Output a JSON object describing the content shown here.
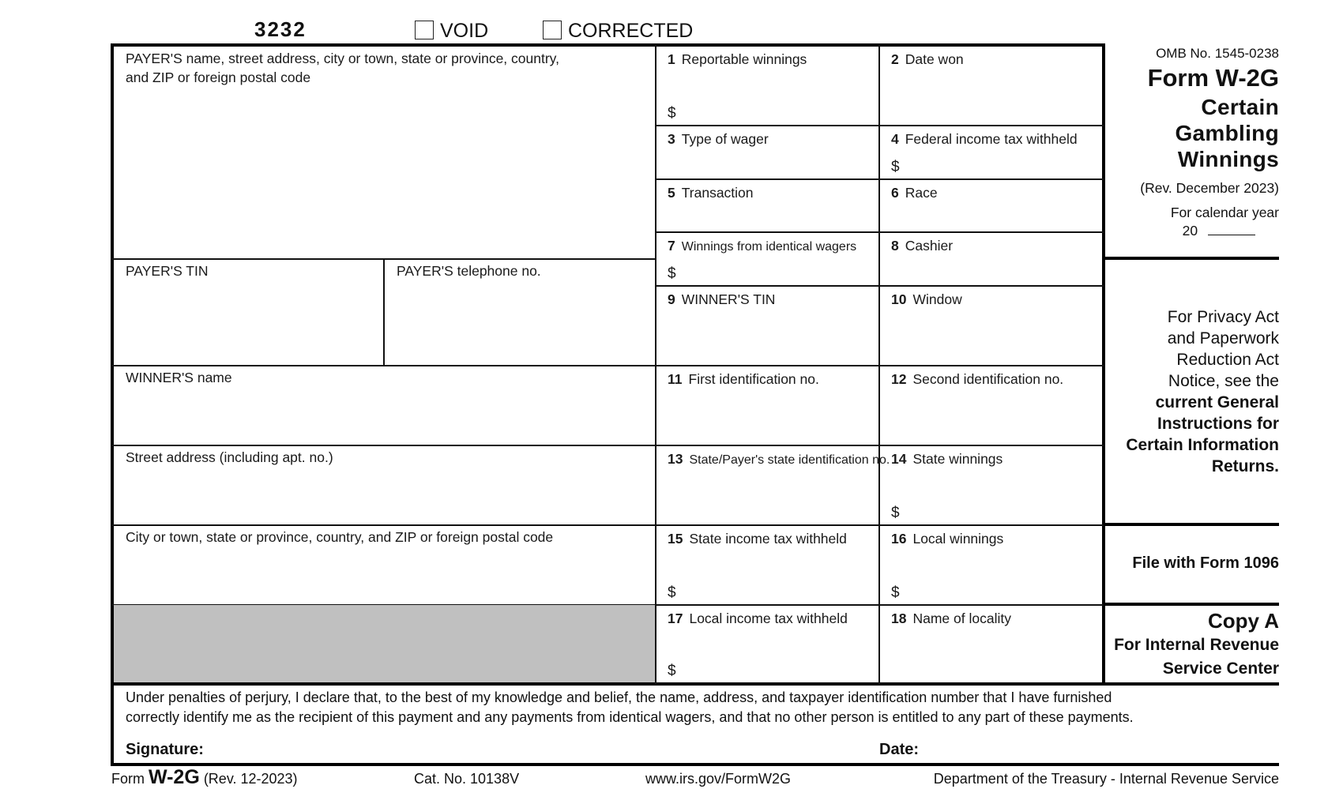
{
  "header": {
    "form_code": "3232",
    "void_label": "VOID",
    "void_checked": false,
    "corrected_label": "CORRECTED",
    "corrected_checked": false
  },
  "left": {
    "payer_name_label": "PAYER'S name, street address, city or town, state or province, country,",
    "payer_name_label_2": "and ZIP or foreign postal code",
    "payer_tin_label": "PAYER'S TIN",
    "payer_phone_label": "PAYER'S telephone no.",
    "winner_name_label": "WINNER'S name",
    "street_label": "Street address (including apt. no.)",
    "city_label": "City or town, state or province, country, and ZIP or foreign postal code"
  },
  "boxes": [
    {
      "num": "1",
      "label": "Reportable winnings",
      "dollar": "$"
    },
    {
      "num": "2",
      "label": "Date won",
      "dollar": ""
    },
    {
      "num": "3",
      "label": "Type of wager",
      "dollar": ""
    },
    {
      "num": "4",
      "label": "Federal income tax withheld",
      "dollar": "$"
    },
    {
      "num": "5",
      "label": "Transaction",
      "dollar": ""
    },
    {
      "num": "6",
      "label": "Race",
      "dollar": ""
    },
    {
      "num": "7",
      "label": "Winnings from identical wagers",
      "dollar": "$"
    },
    {
      "num": "8",
      "label": "Cashier",
      "dollar": ""
    },
    {
      "num": "9",
      "label": "WINNER'S TIN",
      "dollar": ""
    },
    {
      "num": "10",
      "label": "Window",
      "dollar": ""
    },
    {
      "num": "11",
      "label": "First identification no.",
      "dollar": ""
    },
    {
      "num": "12",
      "label": "Second identification no.",
      "dollar": ""
    },
    {
      "num": "13",
      "label": "State/Payer's state identification no.",
      "dollar": ""
    },
    {
      "num": "14",
      "label": "State winnings",
      "dollar": "$"
    },
    {
      "num": "15",
      "label": "State income tax withheld",
      "dollar": "$"
    },
    {
      "num": "16",
      "label": "Local winnings",
      "dollar": "$"
    },
    {
      "num": "17",
      "label": "Local income tax withheld",
      "dollar": "$"
    },
    {
      "num": "18",
      "label": "Name of locality",
      "dollar": ""
    }
  ],
  "side": {
    "omb": "OMB No. 1545-0238",
    "form_title": "Form W-2G",
    "title_line1": "Certain",
    "title_line2": "Gambling",
    "title_line3": "Winnings",
    "rev": "(Rev. December 2023)",
    "calendar_label": "For calendar year",
    "calendar_prefix": "20",
    "privacy_1": "For Privacy Act",
    "privacy_2": "and Paperwork",
    "privacy_3": "Reduction Act",
    "privacy_4": "Notice, see the",
    "privacy_bold_1": "current General",
    "privacy_bold_2": "Instructions for",
    "privacy_bold_3": "Certain Information",
    "privacy_bold_4": "Returns.",
    "file_with": "File with Form 1096",
    "copy": "Copy A",
    "copy_for_1": "For Internal Revenue",
    "copy_for_2": "Service Center"
  },
  "perjury": {
    "line1": "Under penalties of perjury, I declare that, to the best of my knowledge and belief, the name, address, and taxpayer identification number that I have furnished",
    "line2": "correctly identify me as the recipient of this payment and any payments from identical wagers, and that no other person is entitled to any part of these payments.",
    "signature_label": "Signature:",
    "date_label": "Date:"
  },
  "footer": {
    "form_prefix": "Form",
    "form_name": "W-2G",
    "rev": "(Rev. 12-2023)",
    "cat": "Cat. No. 10138V",
    "url": "www.irs.gov/FormW2G",
    "dept": "Department of the Treasury - Internal Revenue Service"
  },
  "colors": {
    "shaded_box": "#c0c0c0"
  }
}
